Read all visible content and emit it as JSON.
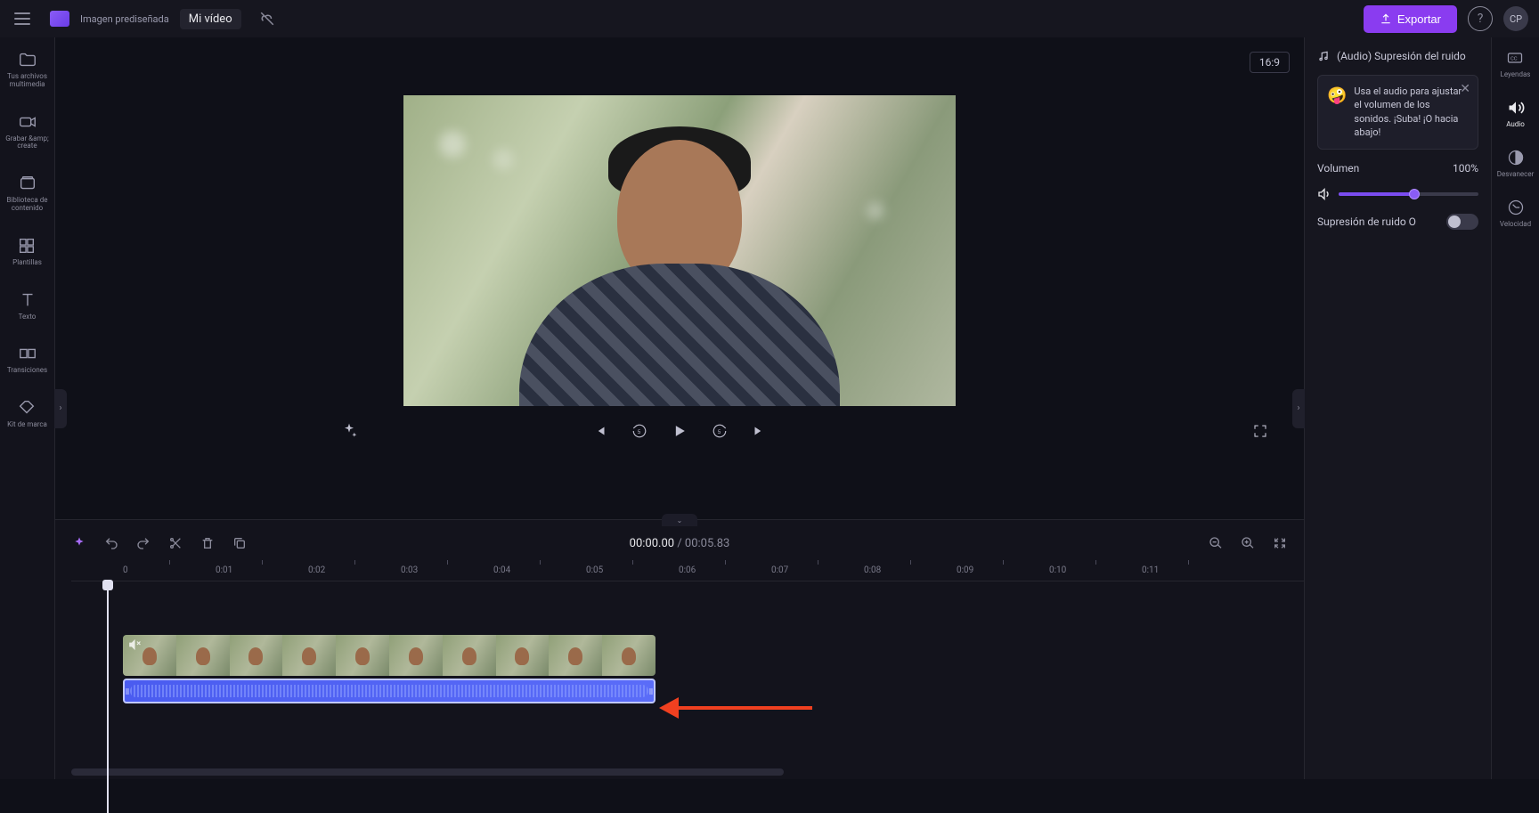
{
  "topbar": {
    "title_prefix": "Imagen prediseñada",
    "title": "Mi vídeo",
    "export_label": "Exportar",
    "avatar_initials": "CP"
  },
  "left_sidebar": {
    "items": [
      {
        "label": "Tus archivos multimedia"
      },
      {
        "label": "Grabar &amp; create"
      },
      {
        "label": "Biblioteca de contenido"
      },
      {
        "label": "Plantillas"
      },
      {
        "label": "Texto"
      },
      {
        "label": "Transiciones"
      },
      {
        "label": "Kit de marca"
      }
    ]
  },
  "preview": {
    "aspect_ratio": "16:9"
  },
  "timeline": {
    "current_time": "00:00.00",
    "total_time": "00:05.83",
    "ruler_marks": [
      "0",
      "0:01",
      "0:02",
      "0:03",
      "0:04",
      "0:05",
      "0:06",
      "0:07",
      "0:08",
      "0:09",
      "0:10",
      "0:11"
    ]
  },
  "right_panel": {
    "header": "(Audio) Supresión del ruido",
    "tip_emoji": "🤪",
    "tip_text": "Usa el audio para ajustar el volumen de los sonidos. ¡Suba! ¡O hacia abajo!",
    "volume_label": "Volumen",
    "volume_value": "100%",
    "noise_label": "Supresión de ruido O"
  },
  "right_sidebar": {
    "items": [
      {
        "label": "Leyendas"
      },
      {
        "label": "Audio"
      },
      {
        "label": "Desvanecer"
      },
      {
        "label": "Velocidad"
      }
    ]
  }
}
